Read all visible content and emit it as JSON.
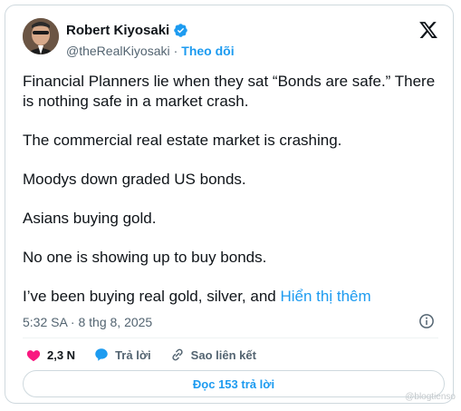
{
  "author": {
    "name": "Robert Kiyosaki",
    "handle": "@theRealKiyosaki",
    "separator": "·",
    "follow_label": "Theo dõi"
  },
  "tweet": {
    "lines": [
      "Financial Planners lie when they sat “Bonds are safe.” There is nothing safe in a market crash.",
      "The commercial real estate market is crashing.",
      "Moodys down graded US bonds.",
      "Asians buying gold.",
      "No one is showing up to buy bonds.",
      "I’ve been buying real gold, silver, and"
    ],
    "show_more": "Hiển thị thêm",
    "timestamp": "5:32 SA · 8 thg 8, 2025"
  },
  "actions": {
    "likes": "2,3 N",
    "reply_label": "Trả lời",
    "copy_link_label": "Sao liên kết"
  },
  "replies_button": "Đọc 153 trả lời",
  "watermark": "@blogtienso",
  "colors": {
    "accent": "#1d9bf0",
    "like": "#f91880",
    "text": "#0f1419",
    "muted": "#536471"
  },
  "icons": [
    "verified-badge-icon",
    "x-logo-icon",
    "info-icon",
    "heart-icon",
    "reply-bubble-icon",
    "link-icon"
  ]
}
